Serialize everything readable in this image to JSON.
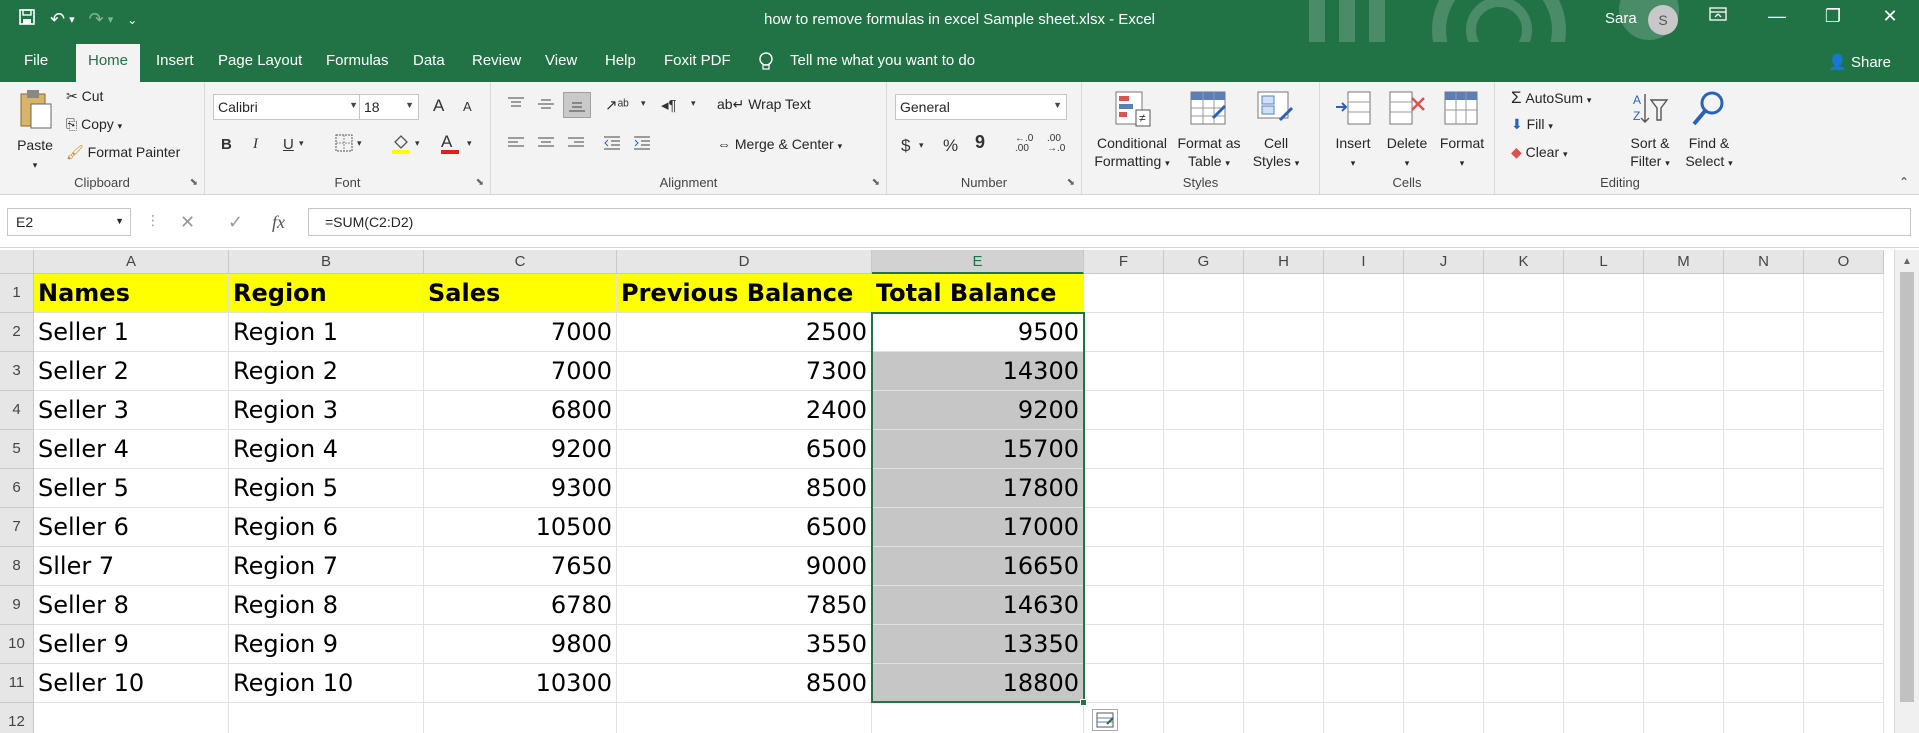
{
  "window": {
    "title": "how to remove formulas in excel Sample sheet.xlsx  -  Excel",
    "user": "Sara",
    "avatar_letter": "S"
  },
  "tabs": [
    "File",
    "Home",
    "Insert",
    "Page Layout",
    "Formulas",
    "Data",
    "Review",
    "View",
    "Help",
    "Foxit PDF"
  ],
  "tell_me": "Tell me what you want to do",
  "share_label": "Share",
  "ribbon": {
    "clipboard": {
      "label": "Clipboard",
      "paste": "Paste",
      "cut": "Cut",
      "copy": "Copy",
      "format_painter": "Format Painter"
    },
    "font": {
      "label": "Font",
      "font_name": "Calibri",
      "font_size": "18",
      "bold": "B",
      "italic": "I",
      "underline": "U",
      "grow": "A",
      "shrink": "A",
      "font_color": "A"
    },
    "alignment": {
      "label": "Alignment",
      "wrap_text": "Wrap Text",
      "merge_center": "Merge & Center"
    },
    "number": {
      "label": "Number",
      "format": "General",
      "currency": "$",
      "percent": "%",
      "comma": "9"
    },
    "styles": {
      "label": "Styles",
      "conditional_line1": "Conditional",
      "conditional_line2": "Formatting",
      "format_table_line1": "Format as",
      "format_table_line2": "Table",
      "cell_styles_line1": "Cell",
      "cell_styles_line2": "Styles"
    },
    "cells": {
      "label": "Cells",
      "insert": "Insert",
      "delete": "Delete",
      "format": "Format"
    },
    "editing": {
      "label": "Editing",
      "autosum": "AutoSum",
      "fill": "Fill",
      "clear": "Clear",
      "sort_line1": "Sort &",
      "sort_line2": "Filter",
      "find_line1": "Find &",
      "find_line2": "Select"
    }
  },
  "formula_bar": {
    "name_box": "E2",
    "formula": "=SUM(C2:D2)",
    "fx": "fx"
  },
  "sheet": {
    "columns": [
      "A",
      "B",
      "C",
      "D",
      "E",
      "F",
      "G",
      "H",
      "I",
      "J",
      "K",
      "L",
      "M",
      "N",
      "O"
    ],
    "selected_column": "E",
    "row_numbers": [
      "1",
      "2",
      "3",
      "4",
      "5",
      "6",
      "7",
      "8",
      "9",
      "10",
      "11",
      "12"
    ],
    "headers": [
      "Names",
      "Region",
      "Sales",
      "Previous Balance",
      "Total Balance"
    ],
    "rows": [
      [
        "Seller 1",
        "Region 1",
        "7000",
        "2500",
        "9500"
      ],
      [
        "Seller 2",
        "Region 2",
        "7000",
        "7300",
        "14300"
      ],
      [
        "Seller 3",
        "Region 3",
        "6800",
        "2400",
        "9200"
      ],
      [
        "Seller 4",
        "Region 4",
        "9200",
        "6500",
        "15700"
      ],
      [
        "Seller 5",
        "Region 5",
        "9300",
        "8500",
        "17800"
      ],
      [
        "Seller 6",
        "Region 6",
        "10500",
        "6500",
        "17000"
      ],
      [
        "Sller 7",
        "Region 7",
        "7650",
        "9000",
        "16650"
      ],
      [
        "Seller 8",
        "Region 8",
        "6780",
        "7850",
        "14630"
      ],
      [
        "Seller 9",
        "Region 9",
        "9800",
        "3550",
        "13350"
      ],
      [
        "Seller 10",
        "Region 10",
        "10300",
        "8500",
        "18800"
      ]
    ]
  },
  "colors": {
    "accent": "#217346",
    "header_fill": "#ffff00",
    "selection_fill": "#c6c6c6"
  }
}
